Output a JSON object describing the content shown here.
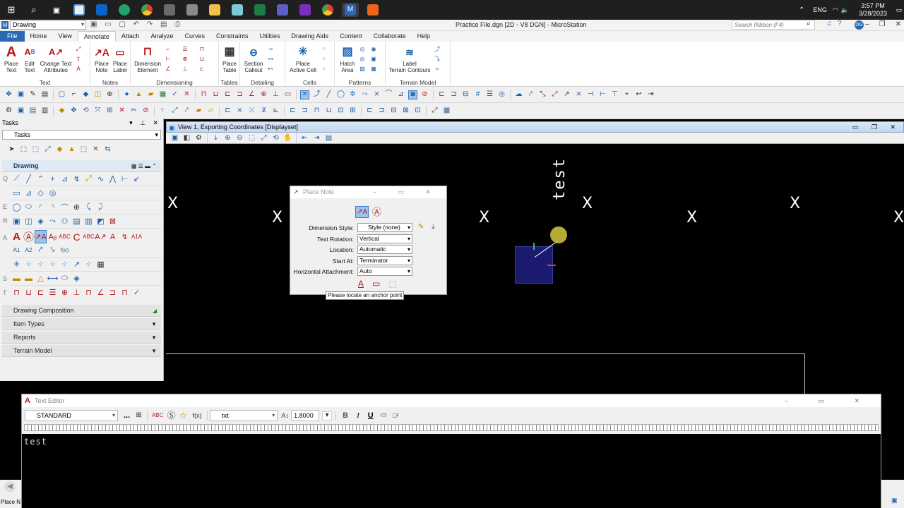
{
  "taskbar": {
    "lang": "ENG",
    "time": "3:57 PM",
    "date": "3/28/2023",
    "apps": [
      "search",
      "task-view",
      "store",
      "outlook",
      "edge",
      "chrome",
      "video",
      "microstation-pin",
      "file-explorer",
      "notes",
      "excel",
      "teams",
      "onenote",
      "chrome-2",
      "microstation",
      "office"
    ]
  },
  "app": {
    "workspace": "Drawing",
    "title": "Practice File.dgn [2D - V8 DGN] - MicroStation",
    "search_placeholder": "Search Ribbon (F4)",
    "user_initials": "DG"
  },
  "menu": [
    "File",
    "Home",
    "View",
    "Annotate",
    "Attach",
    "Analyze",
    "Curves",
    "Constraints",
    "Utilities",
    "Drawing Aids",
    "Content",
    "Collaborate",
    "Help"
  ],
  "menu_active": "Annotate",
  "ribbon": {
    "groups": {
      "text": "Text",
      "notes": "Notes",
      "dimensioning": "Dimensioning",
      "tables": "Tables",
      "detailing": "Detailing",
      "cells": "Cells",
      "patterns": "Patterns",
      "terrain": "Terrain Model"
    },
    "place_text": [
      "Place",
      "Text"
    ],
    "edit_text": [
      "Edit",
      "Text"
    ],
    "change_text": [
      "Change Text",
      "Attributes"
    ],
    "place_note": [
      "Place",
      "Note"
    ],
    "place_label": [
      "Place",
      "Label"
    ],
    "dimension_element": [
      "Dimension",
      "Element"
    ],
    "place_table": [
      "Place",
      "Table"
    ],
    "section_callout": [
      "Section",
      "Callout"
    ],
    "place_active_cell": [
      "Place",
      "Active Cell"
    ],
    "hatch_area": [
      "Hatch",
      "Area"
    ],
    "label_terrain": [
      "Label",
      "Terrain Contours"
    ]
  },
  "tasks": {
    "title": "Tasks",
    "selected": "Tasks",
    "drawing": "Drawing",
    "sections": [
      "Drawing Composition",
      "Item Types",
      "Reports",
      "Terrain Model"
    ]
  },
  "view": {
    "title": "View 1, Exporting Coordinates [Displayset]",
    "drawn_text": "test"
  },
  "place_note": {
    "title": "Place Note",
    "fields": [
      {
        "label": "Dimension Style:",
        "value": "Style (none)"
      },
      {
        "label": "Text Rotation:",
        "value": "Vertical"
      },
      {
        "label": "Location:",
        "value": "Automatic"
      },
      {
        "label": "Start At:",
        "value": "Terminator"
      },
      {
        "label": "Horizontal Attachment:",
        "value": "Auto"
      }
    ],
    "tooltip": "Please locate an anchor point"
  },
  "text_editor": {
    "title": "Text Editor",
    "style": "STANDARD",
    "more": "...",
    "font": "txt",
    "height": "1.8000",
    "bold": "B",
    "italic": "I",
    "underline": "U",
    "content": "test"
  },
  "status": {
    "left": "Place N"
  },
  "colors": {
    "accent": "#2b6ab3",
    "ribbon_red": "#a01818",
    "selection": "#9dc3ea"
  }
}
